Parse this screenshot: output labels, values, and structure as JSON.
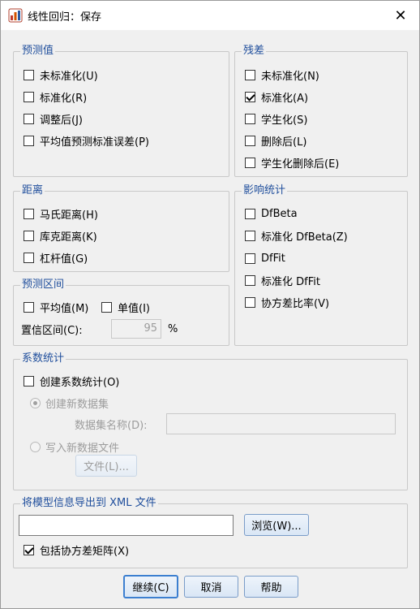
{
  "window": {
    "title": "线性回归：保存",
    "close_glyph": "✕"
  },
  "predicted": {
    "legend": "预测值",
    "items": [
      {
        "label": "未标准化(U)",
        "checked": false
      },
      {
        "label": "标准化(R)",
        "checked": false
      },
      {
        "label": "调整后(J)",
        "checked": false
      },
      {
        "label": "平均值预测标准误差(P)",
        "checked": false
      }
    ]
  },
  "residuals": {
    "legend": "残差",
    "items": [
      {
        "label": "未标准化(N)",
        "checked": false
      },
      {
        "label": "标准化(A)",
        "checked": true
      },
      {
        "label": "学生化(S)",
        "checked": false
      },
      {
        "label": "删除后(L)",
        "checked": false
      },
      {
        "label": "学生化删除后(E)",
        "checked": false
      }
    ]
  },
  "distances": {
    "legend": "距离",
    "items": [
      {
        "label": "马氏距离(H)",
        "checked": false
      },
      {
        "label": "库克距离(K)",
        "checked": false
      },
      {
        "label": "杠杆值(G)",
        "checked": false
      }
    ]
  },
  "influence": {
    "legend": "影响统计",
    "items": [
      {
        "label": "DfBeta",
        "checked": false
      },
      {
        "label": "标准化 DfBeta(Z)",
        "checked": false
      },
      {
        "label": "DfFit",
        "checked": false
      },
      {
        "label": "标准化 DfFit",
        "checked": false
      },
      {
        "label": "协方差比率(V)",
        "checked": false
      }
    ]
  },
  "intervals": {
    "legend": "预测区间",
    "mean_label": "平均值(M)",
    "individual_label": "单值(I)",
    "confidence_label": "置信区间(C):",
    "confidence_value": "95",
    "percent": "%"
  },
  "coefficients": {
    "legend": "系数统计",
    "create_label": "创建系数统计(O)",
    "new_dataset_label": "创建新数据集",
    "dataset_name_label": "数据集名称(D):",
    "dataset_name_value": "",
    "write_file_label": "写入新数据文件",
    "file_button": "文件(L)..."
  },
  "xml": {
    "legend": "将模型信息导出到 XML 文件",
    "path_value": "",
    "browse_button": "浏览(W)...",
    "include_cov_label": "包括协方差矩阵(X)",
    "include_cov_checked": true
  },
  "footer": {
    "continue": "继续(C)",
    "cancel": "取消",
    "help": "帮助"
  }
}
